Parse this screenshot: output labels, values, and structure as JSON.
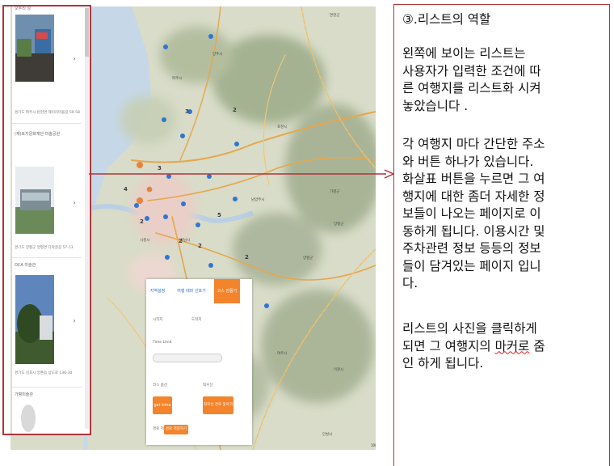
{
  "screenshot": {
    "list": {
      "cards": [
        {
          "title": "오두리 성",
          "address": "경기도 파주시 탄현면 헤이리마을길 59-58"
        },
        {
          "title": "(재)토지문화재단 미술공원",
          "address": "경기도 양평군 양평면 다락골길 57-13"
        },
        {
          "title": "OCA 미술관",
          "address": "경기도 김포시 양촌읍 삼도로 136-30"
        },
        {
          "title": "가평미술관",
          "address": ""
        }
      ],
      "arrow_glyph": "›"
    },
    "panel": {
      "tabs": [
        "지역설정",
        "여행 테마 선호기",
        "코스 만들기"
      ],
      "labels": {
        "origin": "시작지",
        "dest": "도착지",
        "time_limit": "Time Limit",
        "course_option": "코스 옵션",
        "priority": "최우선",
        "save": "경로 저장"
      },
      "buttons": {
        "get_time": "get time",
        "best_route": "최우선 경로 찾아가기",
        "save_route": "경로 저장하기"
      }
    },
    "map": {
      "scale_label": "10km"
    }
  },
  "note": {
    "title": "③.리스트의 역할",
    "p1": [
      "왼쪽에 보이는 리스트는",
      "사용자가 입력한 조건에 따",
      "른 여행지를 리스트화 시켜",
      "놓았습니다 ."
    ],
    "p2": [
      "각 여행지 마다 간단한 주소",
      "와 버튼 하나가 있습니다.",
      "화살표 버튼을 누르면 그 여",
      "행지에 대한 좀더 자세한 정",
      "보들이 나오는 페이지로 이",
      "동하게 됩니다. 이용시간 및",
      "주차관련 정보 등등의 정보",
      "들이 담겨있는 페이지 입니",
      "다."
    ],
    "p3_line1": "리스트의 사진을 클릭하게",
    "p3_line2_a": "되면 그 여행지의 ",
    "p3_line2_b": "마커로",
    "p3_line2_c": " 줌",
    "p3_line3": "인 하게 됩니다."
  },
  "colors": {
    "annotation_red": "#b0343a",
    "accent_orange": "#f3842b",
    "marker_blue": "#2f75d6"
  }
}
